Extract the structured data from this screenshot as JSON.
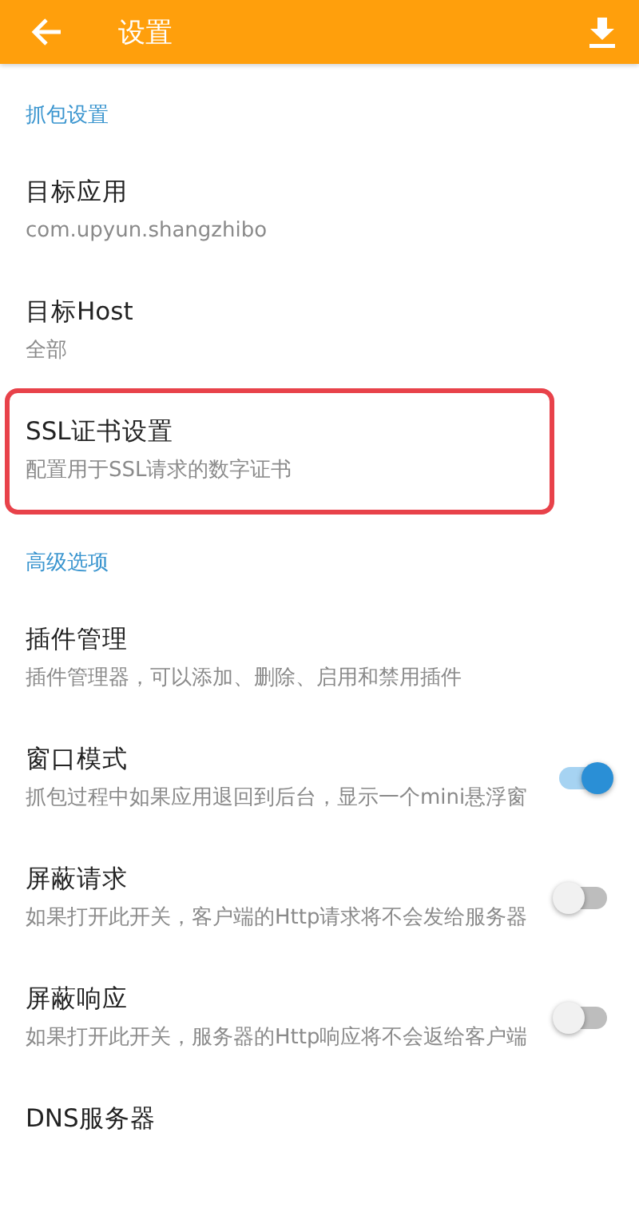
{
  "app_bar": {
    "title": "设置"
  },
  "sections": [
    {
      "header": "抓包设置",
      "items": [
        {
          "kind": "text",
          "title": "目标应用",
          "summary": "com.upyun.shangzhibo",
          "highlighted": false
        },
        {
          "kind": "text",
          "title": "目标Host",
          "summary": "全部",
          "highlighted": false
        },
        {
          "kind": "text",
          "title": "SSL证书设置",
          "summary": "配置用于SSL请求的数字证书",
          "highlighted": true
        }
      ]
    },
    {
      "header": "高级选项",
      "items": [
        {
          "kind": "text",
          "title": "插件管理",
          "summary": "插件管理器，可以添加、删除、启用和禁用插件",
          "highlighted": false
        },
        {
          "kind": "switch",
          "title": "窗口模式",
          "summary": "抓包过程中如果应用退回到后台，显示一个mini悬浮窗",
          "on": true,
          "highlighted": false
        },
        {
          "kind": "switch",
          "title": "屏蔽请求",
          "summary": "如果打开此开关，客户端的Http请求将不会发给服务器",
          "on": false,
          "highlighted": false
        },
        {
          "kind": "switch",
          "title": "屏蔽响应",
          "summary": "如果打开此开关，服务器的Http响应将不会返给客户端",
          "on": false,
          "highlighted": false
        },
        {
          "kind": "text",
          "title": "DNS服务器",
          "highlighted": false
        }
      ]
    }
  ]
}
